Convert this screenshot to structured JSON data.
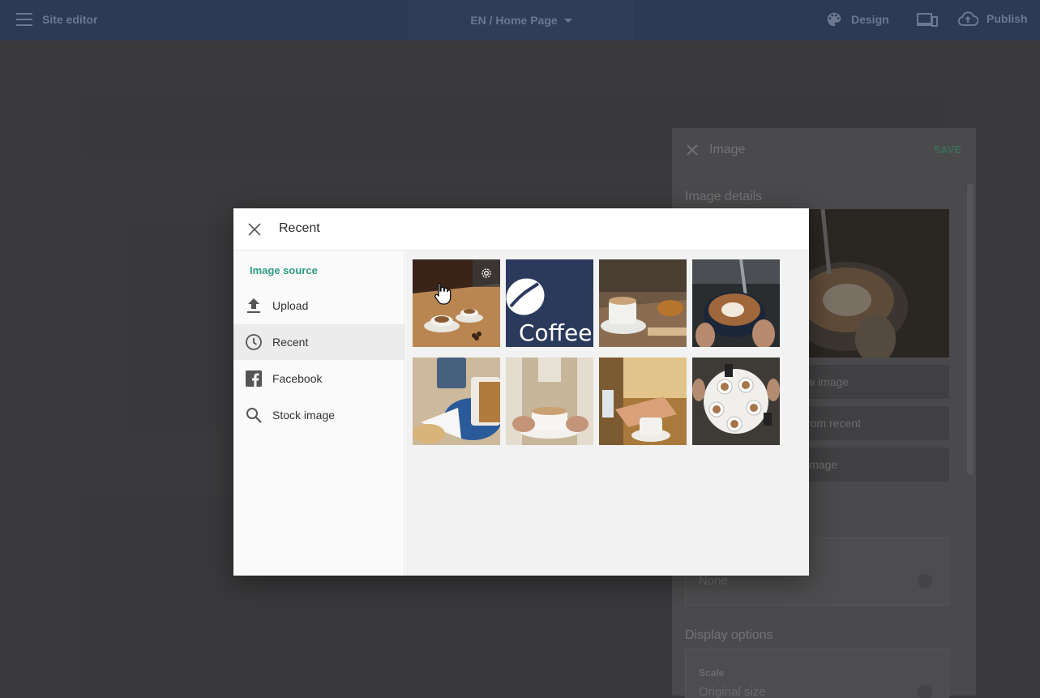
{
  "topbar": {
    "title": "Site editor",
    "page_select": "EN / Home Page",
    "design_label": "Design",
    "publish_label": "Publish"
  },
  "side_panel": {
    "header_title": "Image",
    "save_label": "SAVE",
    "image_details_label": "Image details",
    "button_new": "w image",
    "button_recent": "rom recent",
    "button_stock": "image",
    "link_value": "None",
    "display_options_label": "Display options",
    "scale_label": "Scale",
    "scale_value": "Original size"
  },
  "modal": {
    "title": "Recent",
    "source_label": "Image source",
    "nav": [
      {
        "label": "Upload",
        "icon": "upload-icon"
      },
      {
        "label": "Recent",
        "icon": "clock-icon",
        "active": true
      },
      {
        "label": "Facebook",
        "icon": "facebook-icon"
      },
      {
        "label": "Stock image",
        "icon": "search-icon"
      }
    ],
    "logo_text": "Coffee"
  },
  "colors": {
    "topbar": "#2c3a55",
    "accent_green": "#2f9a82",
    "logo_navy": "#2b3a5c"
  }
}
